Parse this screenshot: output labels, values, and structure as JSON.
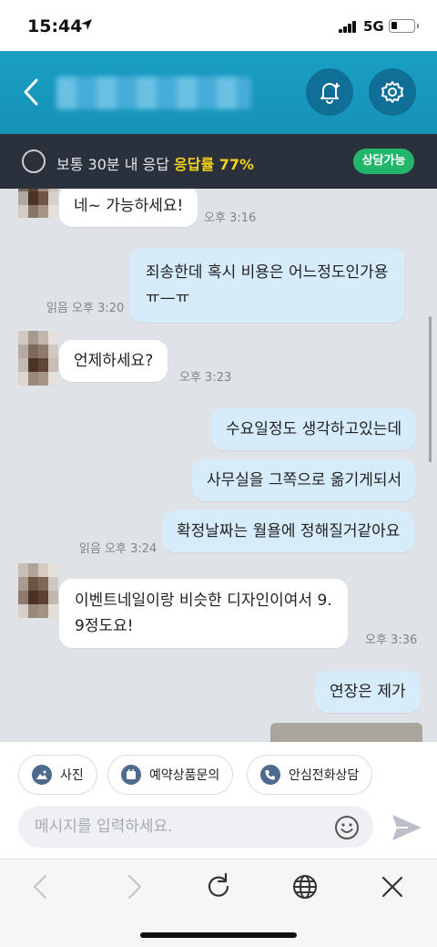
{
  "status_bar": {
    "time": "15:44",
    "location_icon": "location-arrow-icon",
    "signal_icon": "signal-bars-icon",
    "network": "5G",
    "battery_icon": "battery-low-icon"
  },
  "header": {
    "back_icon": "chevron-left-icon",
    "title_blurred": true,
    "bell_icon": "bell-plus-icon",
    "settings_icon": "gear-icon",
    "bg_color": "#1a9fc3"
  },
  "response_bar": {
    "text_prefix": "보통 30분 내 응답",
    "rate_label": "응답률 77%",
    "badge": "상담가능",
    "highlight_color": "#f4d21a",
    "badge_color": "#21b66a"
  },
  "messages": [
    {
      "side": "in",
      "text": "네~ 가능하세요!",
      "time": "오후 3:16"
    },
    {
      "side": "out",
      "lines": [
        "죄송한데 혹시 비용은 어느정도인가용",
        "ㅠ—ㅠ"
      ],
      "read": "읽음 오후 3:20"
    },
    {
      "side": "in",
      "text": "언제하세요?",
      "time": "오후 3:23"
    },
    {
      "side": "out",
      "text": "수요일정도 생각하고있는데"
    },
    {
      "side": "out",
      "text": "사무실을 그쪽으로 옮기게되서"
    },
    {
      "side": "out",
      "text": "확정날짜는 월욜에 정해질거같아요",
      "read": "읽음 오후 3:24"
    },
    {
      "side": "in",
      "lines": [
        "이벤트네일이랑 비슷한 디자인이여서 9.",
        "9정도요!"
      ],
      "time": "오후 3:36"
    },
    {
      "side": "out",
      "text": "연장은 제가"
    }
  ],
  "quick_buttons": [
    {
      "label": "사진",
      "icon": "photo-icon"
    },
    {
      "label": "예약상품문의",
      "icon": "calendar-icon"
    },
    {
      "label": "안심전화상담",
      "icon": "phone-icon"
    }
  ],
  "input": {
    "placeholder": "메시지를 입력하세요.",
    "value": "",
    "emoji_icon": "smile-icon",
    "send_icon": "send-icon"
  },
  "browser_toolbar": {
    "icons": [
      "back-arrow-icon",
      "forward-arrow-icon",
      "reload-icon",
      "globe-icon",
      "close-icon"
    ]
  },
  "colors": {
    "outgoing_bubble": "#d6ecfa",
    "incoming_bubble": "#ffffff",
    "chat_background": "#dfe2e7"
  }
}
